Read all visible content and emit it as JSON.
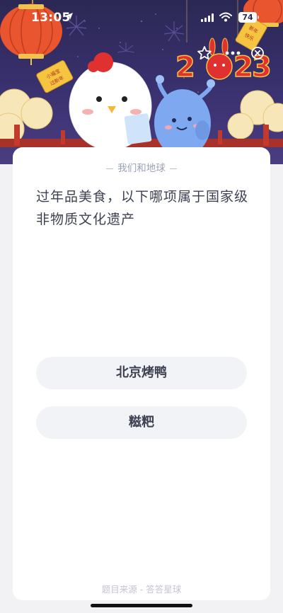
{
  "status_bar": {
    "time": "13:05",
    "battery": "74"
  },
  "banner": {
    "year_text": "2023",
    "lantern_tag_left": "小福宝过新年",
    "lantern_tag_right": "新年快乐"
  },
  "controls": {
    "favorite_icon": "star-outline-icon",
    "more_icon": "more-dots-icon",
    "close_icon": "close-circle-icon"
  },
  "card": {
    "category": "我们和地球",
    "question": "过年品美食，以下哪项属于国家级非物质文化遗产",
    "options": [
      "北京烤鸭",
      "糍粑"
    ],
    "source": "题目来源 - 答答星球"
  },
  "colors": {
    "banner_bg": "#2b2854",
    "card_bg": "#ffffff",
    "option_bg": "#f2f3f6",
    "text_primary": "#3d4152",
    "text_muted": "#9aa0b5",
    "accent_red": "#e0302f"
  }
}
